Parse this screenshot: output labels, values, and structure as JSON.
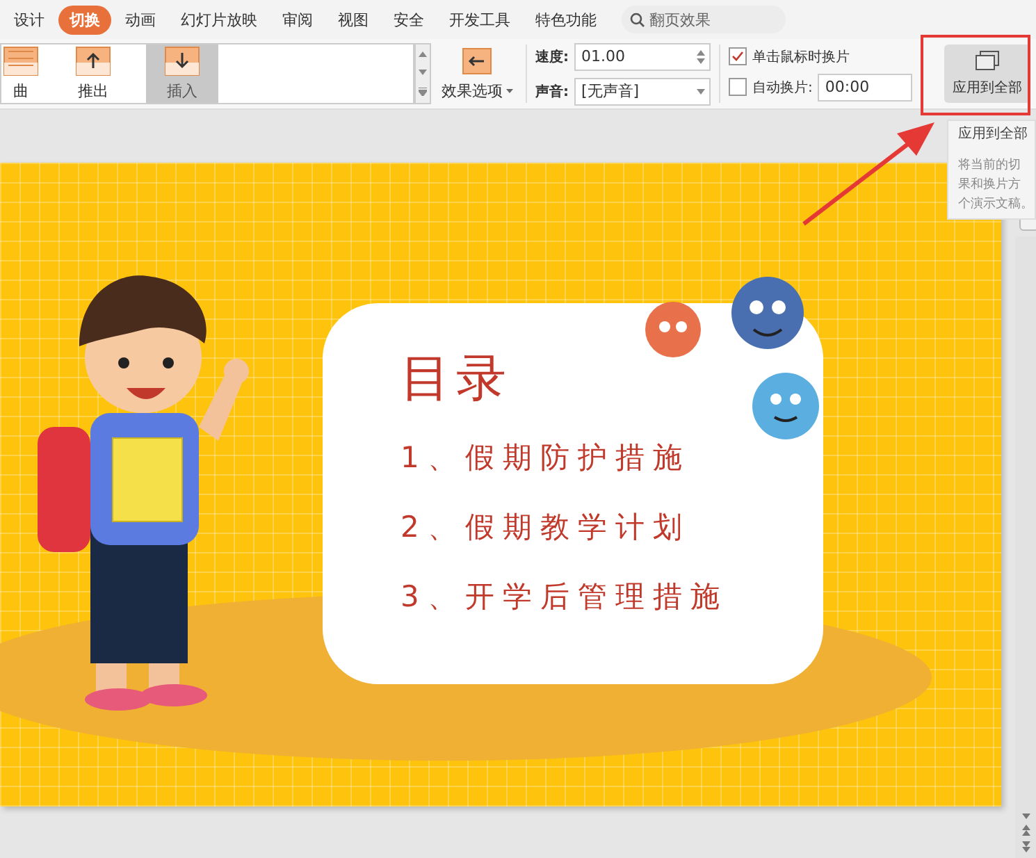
{
  "tabs": [
    {
      "label": "设计",
      "selected": false
    },
    {
      "label": "切换",
      "selected": true
    },
    {
      "label": "动画",
      "selected": false
    },
    {
      "label": "幻灯片放映",
      "selected": false
    },
    {
      "label": "审阅",
      "selected": false
    },
    {
      "label": "视图",
      "selected": false
    },
    {
      "label": "安全",
      "selected": false
    },
    {
      "label": "开发工具",
      "selected": false
    },
    {
      "label": "特色功能",
      "selected": false
    }
  ],
  "search": {
    "placeholder": "翻页效果"
  },
  "transitions": [
    {
      "label": "曲",
      "selected": false
    },
    {
      "label": "推出",
      "selected": false
    },
    {
      "label": "插入",
      "selected": true
    }
  ],
  "effect_options": {
    "label": "效果选项"
  },
  "speed": {
    "label": "速度:",
    "value": "01.00"
  },
  "sound": {
    "label": "声音:",
    "value": "[无声音]"
  },
  "on_click": {
    "label": "单击鼠标时换片",
    "checked": true
  },
  "auto_advance": {
    "label": "自动换片:",
    "checked": false,
    "value": "00:00"
  },
  "apply_all": {
    "label": "应用到全部"
  },
  "tooltip": {
    "title": "应用到全部",
    "lines": [
      "将当前的切",
      "果和换片方",
      "个演示文稿。"
    ]
  },
  "slide": {
    "title": "目录",
    "items": [
      "1、假期防护措施",
      "2、假期教学计划",
      "3、开学后管理措施"
    ]
  }
}
